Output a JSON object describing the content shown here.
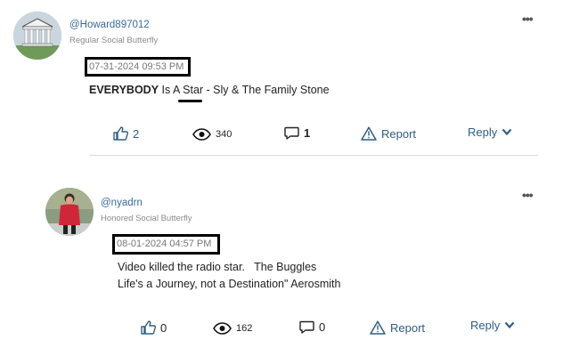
{
  "posts": [
    {
      "username": "@Howard897012",
      "rank": "Regular Social Butterfly",
      "timestamp": "07-31-2024 09:53 PM",
      "body_bold": "EVERYBODY",
      "body_mid": " Is A ",
      "body_star": "Star",
      "body_rest": " - Sly & The Family Stone",
      "kudos": "2",
      "views": "340",
      "comments": "1",
      "report_label": "Report",
      "reply_label": "Reply"
    },
    {
      "username": "@nyadrn",
      "rank": "Honored Social Butterfly",
      "timestamp": "08-01-2024 04:57 PM",
      "body_line1": "Video killed the radio star.   The Buggles",
      "body_line2": "Life's a Journey, not a Destination\" Aerosmith",
      "kudos": "0",
      "views": "162",
      "comments": "0",
      "report_label": "Report",
      "reply_label": "Reply"
    }
  ],
  "colors": {
    "link": "#2f5e86",
    "rank": "#8a8a8a",
    "date_border": "#000000"
  },
  "icons": [
    "thumbs-up-icon",
    "eye-icon",
    "comment-icon",
    "warning-icon",
    "chevron-down-icon",
    "more-options-icon"
  ]
}
